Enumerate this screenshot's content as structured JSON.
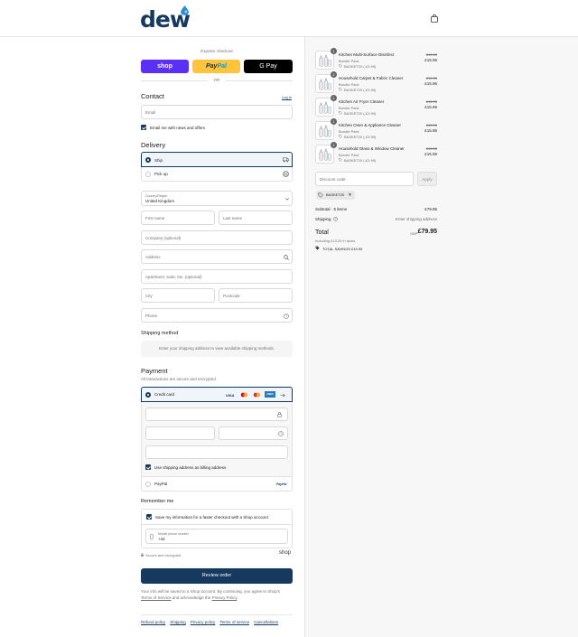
{
  "brand": {
    "logo_text": "dew",
    "accent": "#163a5f"
  },
  "express": {
    "label": "Express checkout",
    "shop": "shop",
    "paypal_pay": "Pay",
    "paypal_pal": "Pal",
    "gpay": "G Pay",
    "or": "OR"
  },
  "contact": {
    "title": "Contact",
    "login": "Log in",
    "email_placeholder": "Email",
    "newsletter": "Email me with news and offers"
  },
  "delivery": {
    "title": "Delivery",
    "ship": "Ship",
    "pickup": "Pick up",
    "country_label": "Country/Region",
    "country_value": "United Kingdom",
    "first_name": "First name",
    "last_name": "Last name",
    "company": "Company (optional)",
    "address": "Address",
    "apartment": "Apartment, suite, etc. (optional)",
    "city": "City",
    "postcode": "Postcode",
    "phone": "Phone"
  },
  "shipping_method": {
    "title": "Shipping method",
    "message": "Enter your shipping address to view available shipping methods."
  },
  "payment": {
    "title": "Payment",
    "subtitle": "All transactions are secure and encrypted.",
    "credit_card": "Credit card",
    "visa": "VISA",
    "amex": "AMEX",
    "billing_same": "Use shipping address as billing address",
    "paypal": "PayPal",
    "paypal_logo": "PayPal"
  },
  "remember": {
    "title": "Remember me",
    "save_info": "Save my information for a faster checkout with a Shop account",
    "phone_label": "Mobile phone number",
    "phone_value": "+44",
    "secure": "Secure and encrypted",
    "shop": "shop"
  },
  "review_button": "Review order",
  "legal": {
    "line1": "Your info will be saved to a Shop account. By continuing, you agree to Shop's",
    "terms": "Terms of Service",
    "and": " and acknowledge the ",
    "privacy": "Privacy Policy",
    "end": "."
  },
  "footer_links": [
    "Refund policy",
    "Shipping",
    "Privacy policy",
    "Terms of service",
    "Cancellations"
  ],
  "cart": {
    "items": [
      {
        "qty": "1",
        "name": "Kitchen Multi-Surface Disinfect",
        "variant": "Bundle Pack",
        "discount": "BASKET20 (-£3.99)",
        "old_price": "£19.95",
        "price": "£15.96"
      },
      {
        "qty": "1",
        "name": "Household Carpet & Fabric Cleaner",
        "variant": "Bundle Pack",
        "discount": "BASKET20 (-£3.99)",
        "old_price": "£19.95",
        "price": "£15.96"
      },
      {
        "qty": "1",
        "name": "Kitchen Air Fryer Cleaner",
        "variant": "Bundle Pack",
        "discount": "BASKET20 (-£3.99)",
        "old_price": "£19.95",
        "price": "£15.96"
      },
      {
        "qty": "1",
        "name": "Kitchen Oven & Appliance Cleaner",
        "variant": "Bundle Pack",
        "discount": "BASKET20 (-£3.99)",
        "old_price": "£19.95",
        "price": "£15.96"
      },
      {
        "qty": "1",
        "name": "Household Glass & Window Cleaner",
        "variant": "Bundle Pack",
        "discount": "BASKET20 (-£3.99)",
        "old_price": "£19.95",
        "price": "£15.96"
      }
    ],
    "discount_placeholder": "Discount code",
    "apply": "Apply",
    "code_tag": "BASKET20",
    "subtotal_label": "Subtotal · 5 items",
    "subtotal_value": "£79.95",
    "shipping_label": "Shipping",
    "shipping_value": "Enter shipping address",
    "total_label": "Total",
    "currency": "GBP",
    "total_value": "£79.95",
    "taxes": "Including £13.29 in taxes",
    "savings_label": "TOTAL SAVINGS",
    "savings_value": "£19.95"
  }
}
